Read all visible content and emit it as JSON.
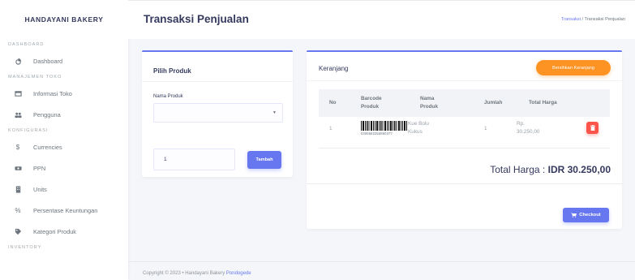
{
  "brand": "HANDAYANI BAKERY",
  "sidebar": {
    "headers": [
      "DASHBOARD",
      "MANAJEMEN TOKO",
      "KONFIGURASI",
      "INVENTORY"
    ],
    "items": [
      {
        "label": "Dashboard",
        "icon": "dashboard-icon"
      },
      {
        "label": "Informasi Toko",
        "icon": "store-icon"
      },
      {
        "label": "Pengguna",
        "icon": "users-icon"
      },
      {
        "label": "Currencies",
        "icon": "dollar-icon"
      },
      {
        "label": "PPN",
        "icon": "money-icon"
      },
      {
        "label": "Units",
        "icon": "building-icon"
      },
      {
        "label": "Persentase Keuntungan",
        "icon": "percent-icon"
      },
      {
        "label": "Kategori Produk",
        "icon": "tag-icon"
      }
    ]
  },
  "header": {
    "title": "Transaksi Penjualan",
    "breadcrumb_link": "Transaksi",
    "breadcrumb_sep": "/",
    "breadcrumb_current": "Transaksi Penjualan"
  },
  "pilih_produk": {
    "title": "Pilih Produk",
    "nama_produk_label": "Nama Produk",
    "select_value": "",
    "quantity_value": "1",
    "tambah_label": "Tambah"
  },
  "keranjang": {
    "title": "Keranjang",
    "bersihkan_label": "Bersihkan Keranjang",
    "columns": {
      "no": "No",
      "barcode_line1": "Barcode",
      "barcode_line2": "Produk",
      "nama_line1": "Nama",
      "nama_line2": "Produk",
      "jumlah": "Jumlah",
      "total": "Total Harga"
    },
    "rows": [
      {
        "no": "1",
        "barcode": "0306582255860377",
        "nama_line1": "Kue Bolu",
        "nama_line2": "Kukus",
        "jumlah": "1",
        "total_line1": "Rp.",
        "total_line2": "30.250,00"
      }
    ],
    "total_label": "Total Harga : ",
    "total_value": "IDR 30.250,00",
    "checkout_label": "Checkout"
  },
  "footer": {
    "text": "Copyright © 2023 • Handayani Bakery ",
    "link": "Pondogede"
  },
  "colors": {
    "primary": "#6777ef",
    "warning": "#fc9323",
    "danger": "#fc544b"
  }
}
